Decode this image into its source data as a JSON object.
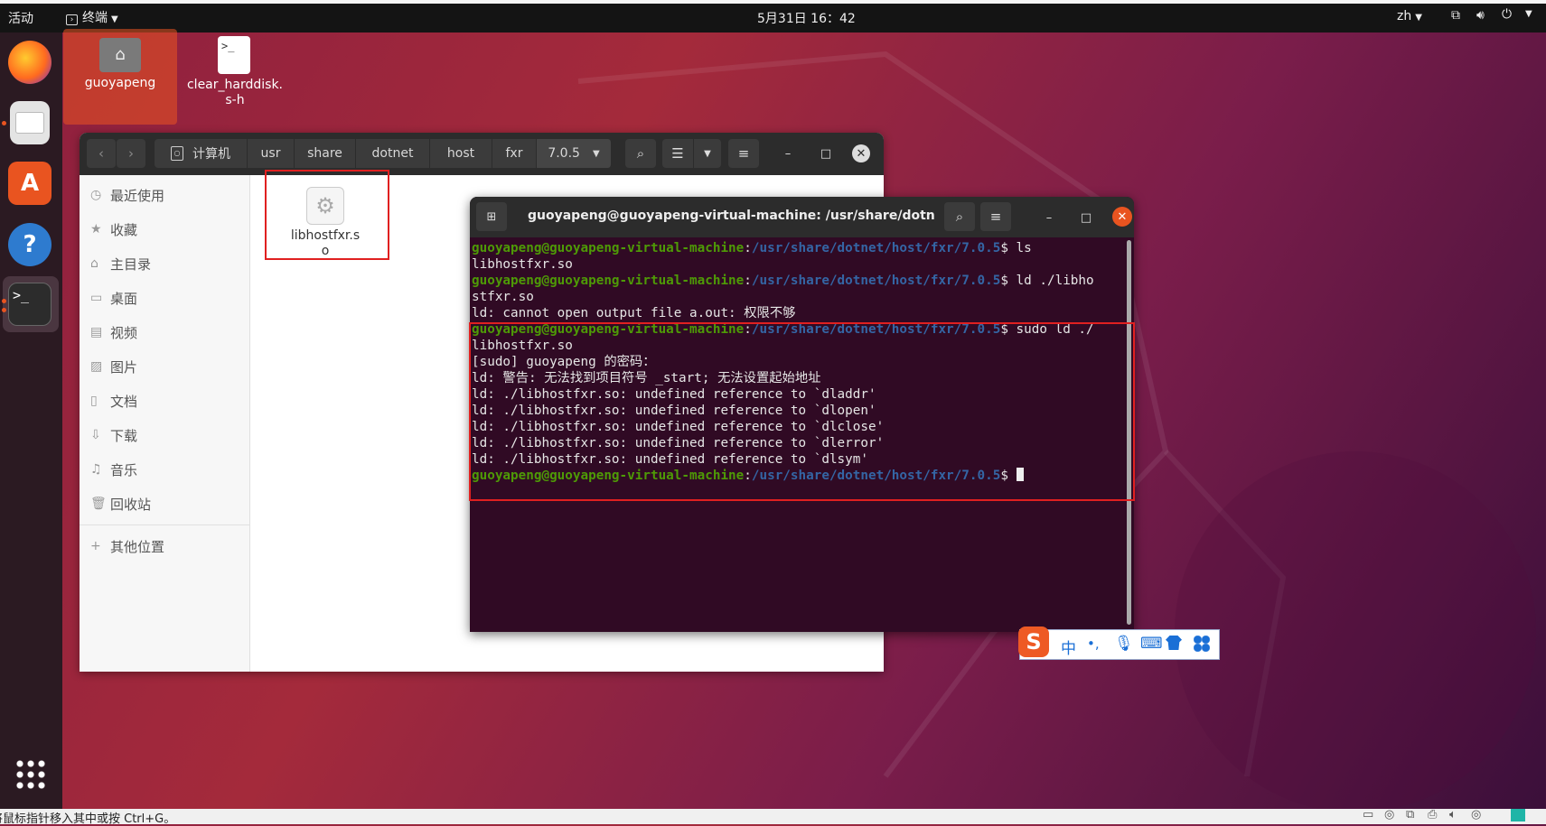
{
  "topbar": {
    "activities": "活动",
    "app_menu": "终端",
    "clock": "5月31日 16：42",
    "lang": "zh"
  },
  "desktop": {
    "icons": [
      {
        "label": "guoyapeng"
      },
      {
        "label": "clear_harddisk.s-h"
      }
    ]
  },
  "file_manager": {
    "breadcrumbs": [
      "计算机",
      "usr",
      "share",
      "dotnet",
      "host",
      "fxr",
      "7.0.5"
    ],
    "sidebar": [
      "最近使用",
      "收藏",
      "主目录",
      "桌面",
      "视频",
      "图片",
      "文档",
      "下载",
      "音乐",
      "回收站",
      "其他位置"
    ],
    "file": {
      "name": "libhostfxr.so"
    }
  },
  "terminal": {
    "title": "guoyapeng@guoyapeng-virtual-machine: /usr/share/dotnet...",
    "user": "guoyapeng@guoyapeng-virtual-machine",
    "path": "/usr/share/dotnet/host/fxr/7.0.5",
    "lines": [
      {
        "cmd": "$ ls"
      },
      {
        "out": "libhostfxr.so"
      },
      {
        "cmd": "$ ld ./libho"
      },
      {
        "out": "stfxr.so"
      },
      {
        "out": "ld: cannot open output file a.out: 权限不够"
      },
      {
        "cmd": "$ sudo ld ./"
      },
      {
        "out": "libhostfxr.so"
      },
      {
        "out": "[sudo] guoyapeng 的密码："
      },
      {
        "out": "ld: 警告: 无法找到项目符号 _start; 无法设置起始地址"
      },
      {
        "out": "ld: ./libhostfxr.so: undefined reference to `dladdr'"
      },
      {
        "out": "ld: ./libhostfxr.so: undefined reference to `dlopen'"
      },
      {
        "out": "ld: ./libhostfxr.so: undefined reference to `dlclose'"
      },
      {
        "out": "ld: ./libhostfxr.so: undefined reference to `dlerror'"
      },
      {
        "out": "ld: ./libhostfxr.so: undefined reference to `dlsym'"
      },
      {
        "cmd": "$ "
      }
    ]
  },
  "ime": {
    "logo": "S",
    "mode": "中",
    "punct": "•,"
  },
  "statusbar": {
    "hint": "将鼠标指针移入其中或按 Ctrl+G。"
  },
  "colors": {
    "accent": "#e95420",
    "terminal_bg": "#300a24",
    "prompt_user": "#4e9a06",
    "prompt_path": "#3465a4",
    "highlight_box": "#e02020"
  }
}
